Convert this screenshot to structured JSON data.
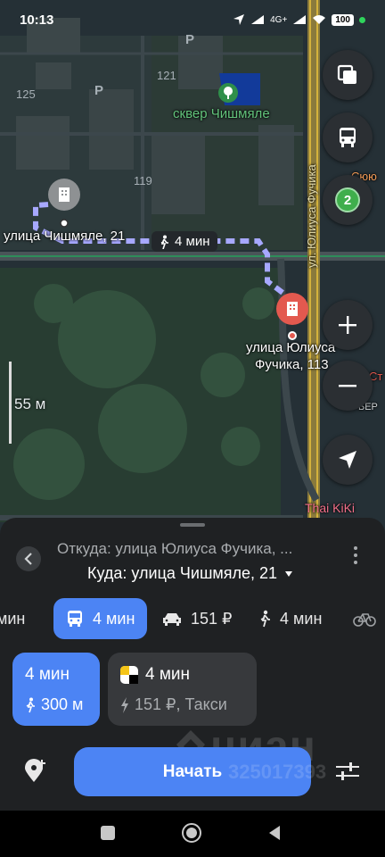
{
  "status_bar": {
    "time": "10:13",
    "network": "4G+",
    "battery": "100"
  },
  "map": {
    "building_numbers": [
      "125",
      "121",
      "119"
    ],
    "parking_label": "P",
    "park_name": "сквер Чишмяле",
    "street_vertical": "ул. Юлиуса Фучика",
    "origin_label": "улица Чишмяле, 21",
    "destination_label_line1": "улица Юлиуса",
    "destination_label_line2": "Фучика, 113",
    "walk_time": "4 мин",
    "scale": "55 м",
    "poi_cut_1": "Сюю",
    "poi_cut_2": "Ст",
    "poi_cut_3": "БЕР",
    "poi_thai": "Thai KiKi",
    "bus_stop_badge": "2"
  },
  "route_panel": {
    "from": "Откуда: улица Юлиуса Фучика, ...",
    "to": "Куда: улица Чишмяле, 21",
    "modes": [
      {
        "icon": "partial",
        "label": "мин"
      },
      {
        "icon": "bus-icon",
        "label": "4 мин"
      },
      {
        "icon": "taxi-icon",
        "label": "151 ₽"
      },
      {
        "icon": "walk-icon",
        "label": "4 мин"
      },
      {
        "icon": "bike-icon",
        "label": ""
      }
    ],
    "primary_card": {
      "time": "4 мин",
      "walk": "300 м"
    },
    "taxi_card": {
      "time": "4 мин",
      "price": "151 ₽, Такси"
    },
    "start_label": "Начать",
    "watermark": "циан",
    "watermark_number": "325017393"
  },
  "colors": {
    "accent": "#4c84f4",
    "route": "#9aa0ff",
    "pin": "#e3594f",
    "park": "#3c8f4f"
  }
}
